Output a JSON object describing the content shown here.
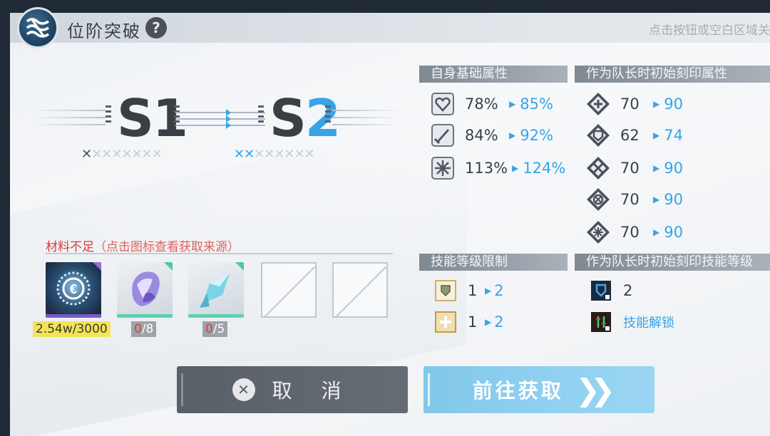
{
  "header": {
    "title": "位阶突破",
    "help_icon": "?",
    "close_hint": "点击按钮或空白区域关"
  },
  "rank": {
    "current_prefix": "S",
    "current_num": "1",
    "next_prefix": "S",
    "next_num": "2",
    "current_chain_on": "✕",
    "current_chain_off": "✕✕✕✕✕✕✕",
    "next_chain_on": "✕✕",
    "next_chain_off": "✕✕✕✕✕✕"
  },
  "materials": {
    "header": "材料不足",
    "subheader": "（点击图标查看获取来源）",
    "items": [
      {
        "name": "coin",
        "count_text": "2.54w/3000",
        "style": "yellow"
      },
      {
        "name": "purple-crystal",
        "have": "0",
        "need": "/8",
        "style": "grey"
      },
      {
        "name": "cyan-crystal",
        "have": "0",
        "need": "/5",
        "style": "grey"
      }
    ]
  },
  "self_attrs": {
    "title": "自身基础属性",
    "rows": [
      {
        "icon": "heart-icon",
        "old": "78%",
        "new": "85%"
      },
      {
        "icon": "sword-icon",
        "old": "84%",
        "new": "92%"
      },
      {
        "icon": "cross-icon",
        "old": "113%",
        "new": "124%"
      }
    ]
  },
  "leader_attrs": {
    "title": "作为队长时初始刻印属性",
    "rows": [
      {
        "icon": "plus-diamond-icon",
        "old": "70",
        "new": "90"
      },
      {
        "icon": "shield-diamond-icon",
        "old": "62",
        "new": "74"
      },
      {
        "icon": "swords-diamond-icon",
        "old": "70",
        "new": "90"
      },
      {
        "icon": "compass-diamond-icon",
        "old": "70",
        "new": "90"
      },
      {
        "icon": "star-diamond-icon",
        "old": "70",
        "new": "90"
      }
    ]
  },
  "skill_limit": {
    "title": "技能等级限制",
    "rows": [
      {
        "icon": "skill-gold-shield-icon",
        "old": "1",
        "new": "2"
      },
      {
        "icon": "skill-gold-plus-icon",
        "old": "1",
        "new": "2"
      }
    ]
  },
  "leader_skill": {
    "title": "作为队长时初始刻印技能等级",
    "rows": [
      {
        "icon": "skill-blue-shield-icon",
        "text": "2"
      },
      {
        "icon": "skill-green-icon",
        "text": "技能解锁"
      }
    ]
  },
  "buttons": {
    "cancel": "取 消",
    "go": "前往获取",
    "go_arrow": "❯❯"
  },
  "colors": {
    "accent": "#39a3e8",
    "warning": "#d8403c",
    "count_yellow": "#f3e35a"
  }
}
